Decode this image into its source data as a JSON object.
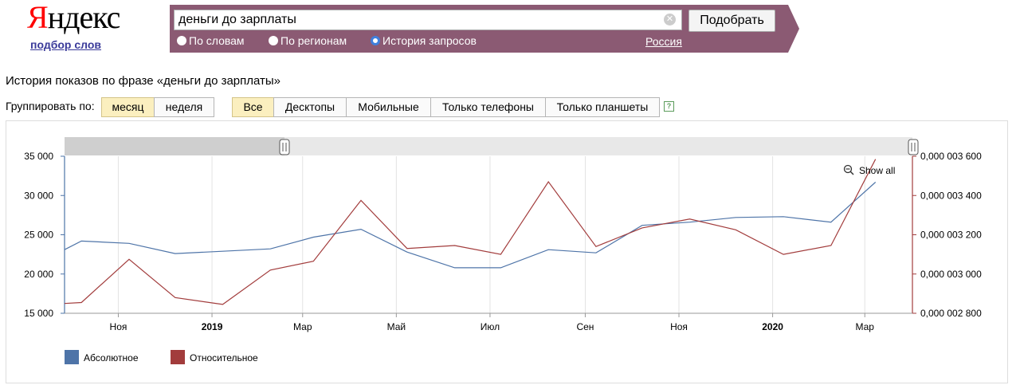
{
  "logo": {
    "first_letter": "Я",
    "rest": "ндекс"
  },
  "sublink": "подбор слов",
  "search": {
    "query": "деньги до зарплаты",
    "clear_icon": "clear-icon",
    "submit_label": "Подобрать"
  },
  "modes": [
    {
      "label": "По словам",
      "selected": false
    },
    {
      "label": "По регионам",
      "selected": false
    },
    {
      "label": "История запросов",
      "selected": true
    }
  ],
  "region": "Россия",
  "heading": "История показов по фразе «деньги до зарплаты»",
  "group_label": "Группировать по:",
  "group_buttons": [
    {
      "label": "месяц",
      "active": true
    },
    {
      "label": "неделя",
      "active": false
    }
  ],
  "device_buttons": [
    {
      "label": "Все",
      "active": true
    },
    {
      "label": "Десктопы",
      "active": false
    },
    {
      "label": "Мобильные",
      "active": false
    },
    {
      "label": "Только телефоны",
      "active": false
    },
    {
      "label": "Только планшеты",
      "active": false
    }
  ],
  "help_icon": "?",
  "colors": {
    "absolute": "#4e74a8",
    "relative": "#a23c3c",
    "header_bar": "#8b5a73"
  },
  "chart_data": {
    "type": "line",
    "show_all": "Show all",
    "x_ticks": [
      {
        "label": "Ноя",
        "bold": false
      },
      {
        "label": "2019",
        "bold": true
      },
      {
        "label": "Мар",
        "bold": false
      },
      {
        "label": "Май",
        "bold": false
      },
      {
        "label": "Июл",
        "bold": false
      },
      {
        "label": "Сен",
        "bold": false
      },
      {
        "label": "Ноя",
        "bold": false
      },
      {
        "label": "2020",
        "bold": true
      },
      {
        "label": "Мар",
        "bold": false
      }
    ],
    "y_left": {
      "ticks": [
        "15 000",
        "20 000",
        "25 000",
        "30 000",
        "35 000"
      ],
      "ylim": [
        15000,
        35000
      ]
    },
    "y_right": {
      "ticks": [
        "0,000 002 800",
        "0,000 003 000",
        "0,000 003 200",
        "0,000 003 400",
        "0,000 003 600"
      ],
      "ylim": [
        2.8e-06,
        3.6e-06
      ]
    },
    "series": [
      {
        "name": "Абсолютное",
        "axis": "left",
        "points": [
          [
            "2018-09-27",
            23100
          ],
          [
            "2018-10-08",
            24200
          ],
          [
            "2018-11-08",
            23900
          ],
          [
            "2018-12-08",
            22600
          ],
          [
            "2019-01-08",
            22900
          ],
          [
            "2019-02-08",
            23200
          ],
          [
            "2019-03-08",
            24700
          ],
          [
            "2019-04-08",
            25700
          ],
          [
            "2019-05-08",
            22800
          ],
          [
            "2019-06-08",
            20800
          ],
          [
            "2019-07-08",
            20800
          ],
          [
            "2019-08-08",
            23100
          ],
          [
            "2019-09-08",
            22700
          ],
          [
            "2019-10-08",
            26200
          ],
          [
            "2019-11-08",
            26600
          ],
          [
            "2019-12-08",
            27200
          ],
          [
            "2020-01-08",
            27300
          ],
          [
            "2020-02-08",
            26600
          ],
          [
            "2020-03-08",
            31700
          ]
        ]
      },
      {
        "name": "Относительное",
        "axis": "right",
        "points": [
          [
            "2018-09-27",
            2.85e-06
          ],
          [
            "2018-10-08",
            2.855e-06
          ],
          [
            "2018-11-08",
            3.075e-06
          ],
          [
            "2018-12-08",
            2.88e-06
          ],
          [
            "2019-01-08",
            2.845e-06
          ],
          [
            "2019-02-08",
            3.02e-06
          ],
          [
            "2019-03-08",
            3.065e-06
          ],
          [
            "2019-04-08",
            3.375e-06
          ],
          [
            "2019-05-08",
            3.13e-06
          ],
          [
            "2019-06-08",
            3.145e-06
          ],
          [
            "2019-07-08",
            3.1e-06
          ],
          [
            "2019-08-08",
            3.47e-06
          ],
          [
            "2019-09-08",
            3.14e-06
          ],
          [
            "2019-10-08",
            3.235e-06
          ],
          [
            "2019-11-08",
            3.28e-06
          ],
          [
            "2019-12-08",
            3.225e-06
          ],
          [
            "2020-01-08",
            3.1e-06
          ],
          [
            "2020-02-08",
            3.145e-06
          ],
          [
            "2020-03-08",
            3.585e-06
          ]
        ]
      }
    ]
  }
}
